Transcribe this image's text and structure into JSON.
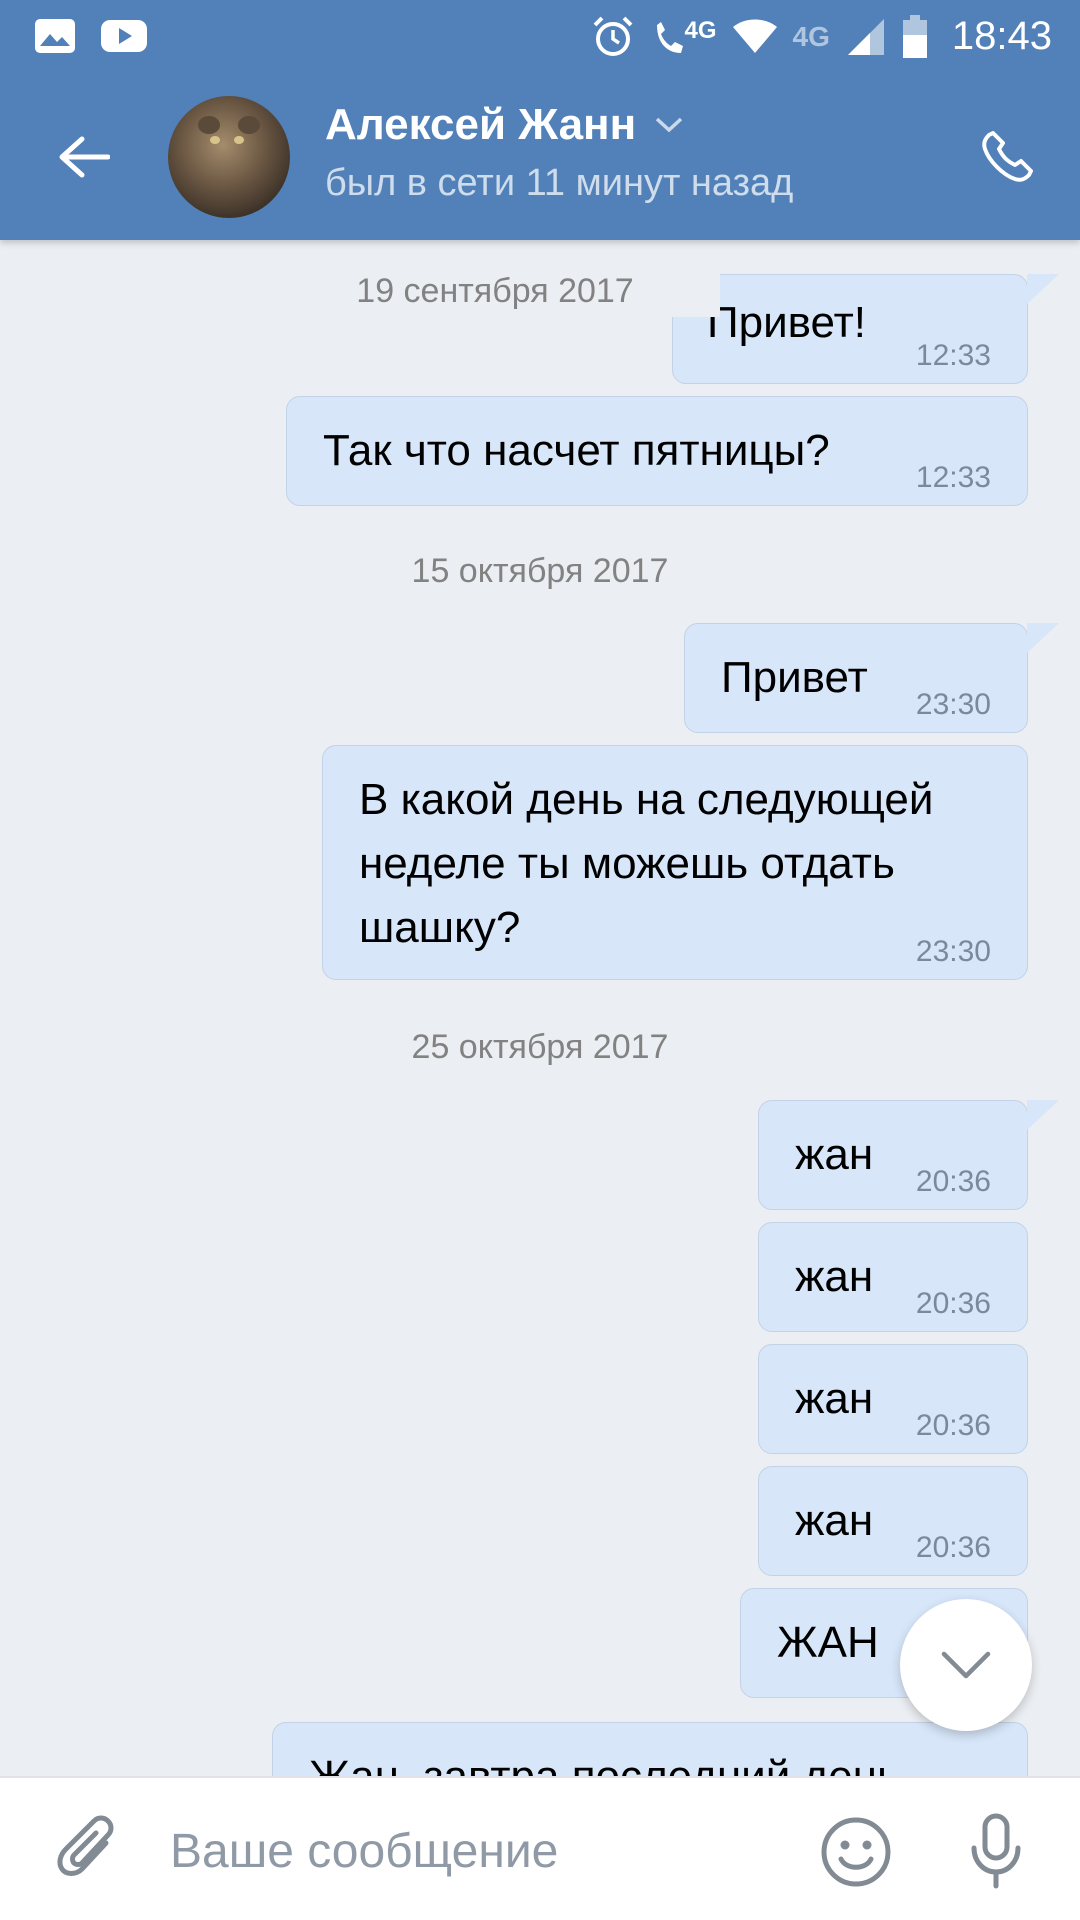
{
  "status_bar": {
    "network_1": "4G",
    "network_2": "4G",
    "time": "18:43"
  },
  "header": {
    "contact_name": "Алексей Жанн",
    "contact_status": "был в сети 11 минут назад"
  },
  "thread": {
    "dates": [
      "19 сентября 2017",
      "15 октября 2017",
      "25 октября 2017"
    ],
    "messages": [
      {
        "text": "Привет!",
        "time": "12:33"
      },
      {
        "text": "Так что насчет пятницы?",
        "time": "12:33"
      },
      {
        "text": "Привет",
        "time": "23:30"
      },
      {
        "text": "В какой день на следующей неделе ты можешь отдать шашку?",
        "time": "23:30"
      },
      {
        "text": "жан",
        "time": "20:36"
      },
      {
        "text": "жан",
        "time": "20:36"
      },
      {
        "text": "жан",
        "time": "20:36"
      },
      {
        "text": "жан",
        "time": "20:36"
      },
      {
        "text": "ЖАН",
        "time": ""
      },
      {
        "text": "Жан, завтра последний день",
        "time": ""
      }
    ]
  },
  "composer": {
    "placeholder": "Ваше сообщение"
  },
  "colors": {
    "header_bg": "#5181b8",
    "bubble_bg": "#d7e6f9",
    "thread_bg": "#ebeef2"
  }
}
